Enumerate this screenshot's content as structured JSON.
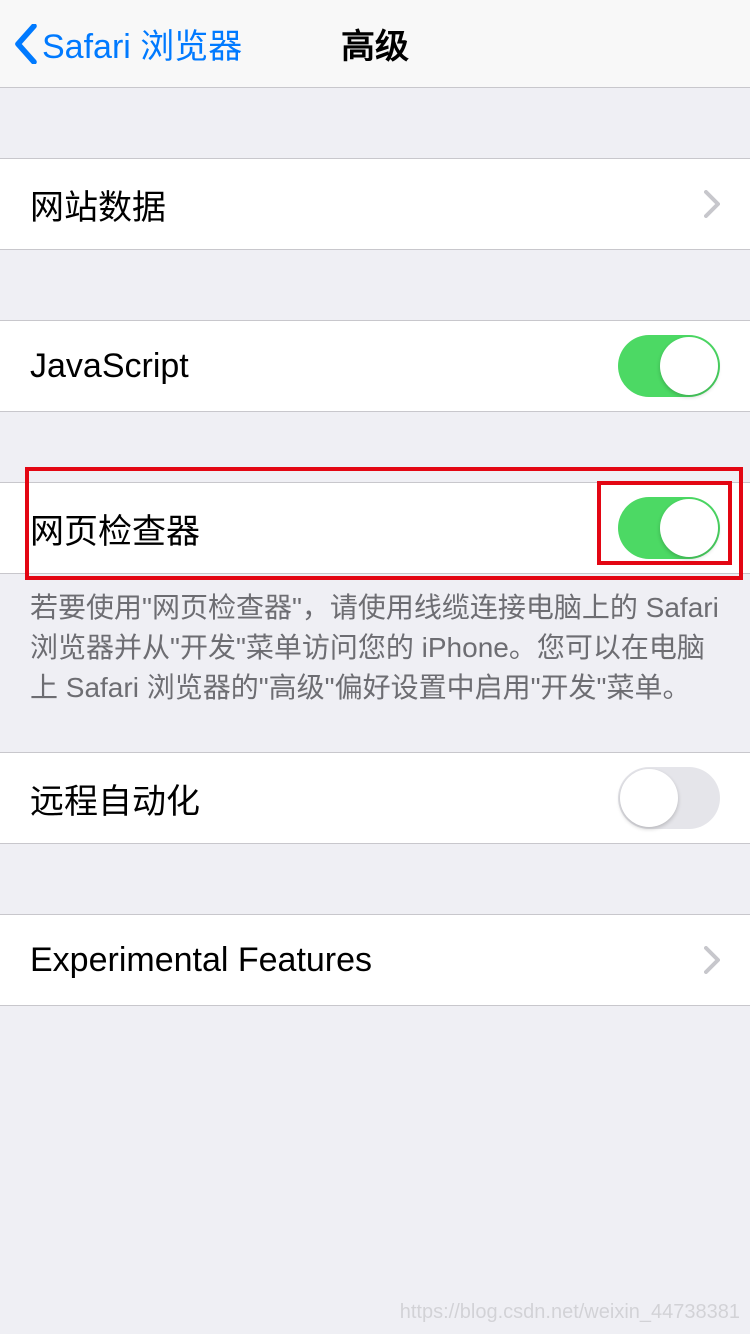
{
  "navbar": {
    "back_label": "Safari 浏览器",
    "title": "高级"
  },
  "rows": {
    "website_data": {
      "label": "网站数据"
    },
    "javascript": {
      "label": "JavaScript"
    },
    "web_inspector": {
      "label": "网页检查器"
    },
    "remote_automation": {
      "label": "远程自动化"
    },
    "experimental": {
      "label": "Experimental Features"
    }
  },
  "web_inspector_footer": "若要使用\"网页检查器\"，请使用线缆连接电脑上的 Safari 浏览器并从\"开发\"菜单访问您的 iPhone。您可以在电脑上 Safari 浏览器的\"高级\"偏好设置中启用\"开发\"菜单。",
  "watermark": "https://blog.csdn.net/weixin_44738381"
}
